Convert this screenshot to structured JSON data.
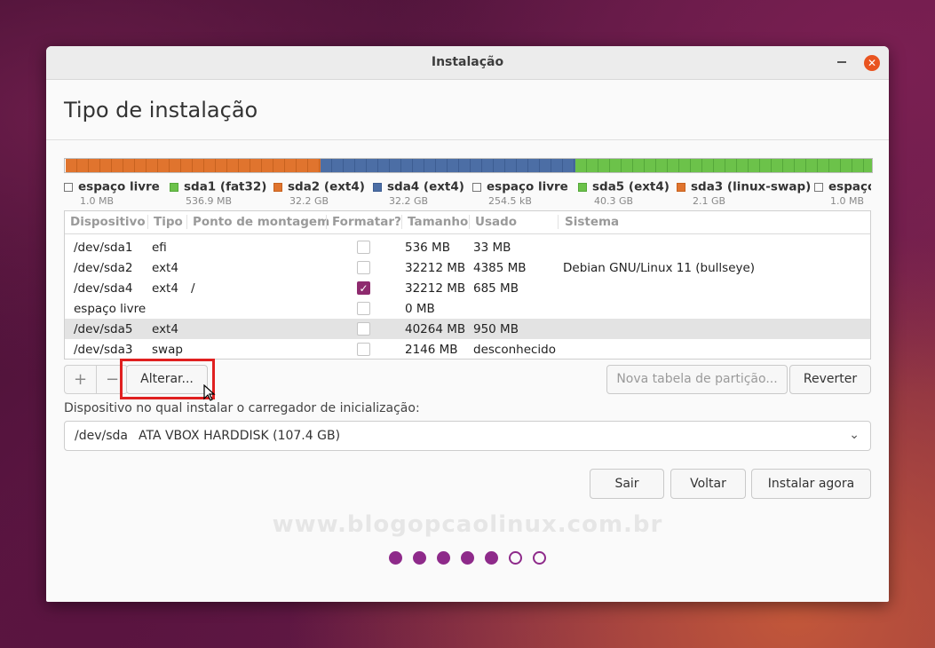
{
  "window": {
    "title": "Instalação",
    "page_title": "Tipo de instalação"
  },
  "colors": {
    "accent": "#8e2a6e",
    "close": "#e95420",
    "ext4": "#e0742e",
    "fat32": "#6cc24a",
    "sda4": "#4c6ea5",
    "swap": "#e0742e",
    "free": "#ffffff"
  },
  "legend": [
    {
      "name": "espaço livre",
      "size": "1.0 MB",
      "color": "#ffffff"
    },
    {
      "name": "sda1 (fat32)",
      "size": "536.9 MB",
      "color": "#6cc24a"
    },
    {
      "name": "sda2 (ext4)",
      "size": "32.2 GB",
      "color": "#e0742e"
    },
    {
      "name": "sda4 (ext4)",
      "size": "32.2 GB",
      "color": "#4c6ea5"
    },
    {
      "name": "espaço livre",
      "size": "254.5 kB",
      "color": "#ffffff"
    },
    {
      "name": "sda5 (ext4)",
      "size": "40.3 GB",
      "color": "#6cc24a"
    },
    {
      "name": "sda3 (linux-swap)",
      "size": "2.1 GB",
      "color": "#e0742e"
    },
    {
      "name": "espaço",
      "size": "1.0 MB",
      "color": "#ffffff"
    }
  ],
  "table": {
    "headers": [
      "Dispositivo",
      "Tipo",
      "Ponto de montagem",
      "Formatar?",
      "Tamanho",
      "Usado",
      "Sistema"
    ],
    "rows": [
      {
        "device": "/dev/sda1",
        "type": "efi",
        "mount": "",
        "format": false,
        "size": "536 MB",
        "used": "33 MB",
        "system": ""
      },
      {
        "device": "/dev/sda2",
        "type": "ext4",
        "mount": "",
        "format": false,
        "size": "32212 MB",
        "used": "4385 MB",
        "system": "Debian GNU/Linux 11 (bullseye)"
      },
      {
        "device": "/dev/sda4",
        "type": "ext4",
        "mount": "/",
        "format": true,
        "size": "32212 MB",
        "used": "685 MB",
        "system": ""
      },
      {
        "device": "espaço livre",
        "type": "",
        "mount": "",
        "format": false,
        "size": "0 MB",
        "used": "",
        "system": ""
      },
      {
        "device": "/dev/sda5",
        "type": "ext4",
        "mount": "",
        "format": false,
        "size": "40264 MB",
        "used": "950 MB",
        "system": "",
        "selected": true
      },
      {
        "device": "/dev/sda3",
        "type": "swap",
        "mount": "",
        "format": false,
        "size": "2146 MB",
        "used": "desconhecido",
        "system": ""
      }
    ]
  },
  "toolbar": {
    "add": "+",
    "remove": "−",
    "change": "Alterar...",
    "new_table": "Nova tabela de partição...",
    "revert": "Reverter"
  },
  "boot": {
    "label": "Dispositivo no qual instalar o carregador de inicialização:",
    "device": "/dev/sda",
    "description": "ATA VBOX HARDDISK (107.4 GB)"
  },
  "buttons": {
    "quit": "Sair",
    "back": "Voltar",
    "install": "Instalar agora"
  },
  "watermark": "www.blogopcaolinux.com.br",
  "progress": {
    "total_steps": 7,
    "completed_steps": 5
  }
}
